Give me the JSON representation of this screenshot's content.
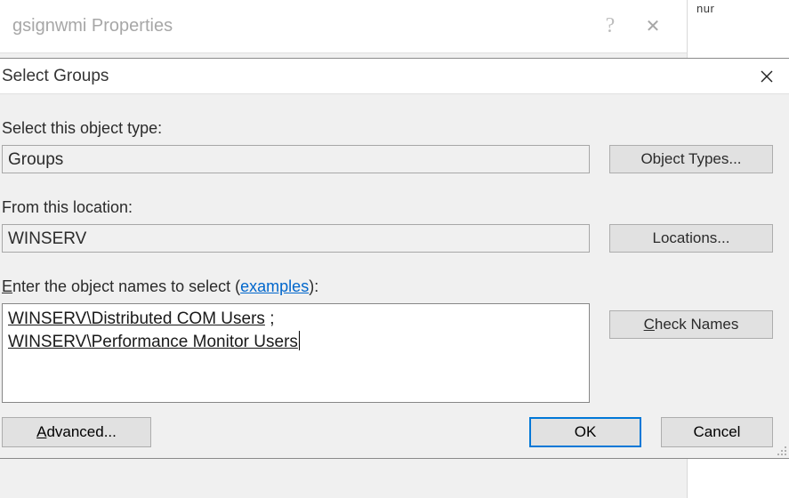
{
  "parent_window": {
    "title": "gsignwmi Properties",
    "help_glyph": "?",
    "close_glyph": "✕"
  },
  "right_strip": {
    "fragment": "nur"
  },
  "dialog": {
    "title": "Select Groups",
    "labels": {
      "object_type": "Select this object type:",
      "from_location": "From this location:",
      "enter_names_prefix": "E",
      "enter_names_rest": "nter the object names to select (",
      "examples_link": "examples",
      "enter_names_suffix": "):"
    },
    "values": {
      "object_type": "Groups",
      "from_location": "WINSERV",
      "name_line1": "WINSERV\\Distributed COM Users",
      "name_sep": " ;",
      "name_line2": "WINSERV\\Performance Monitor Users"
    },
    "buttons": {
      "object_types": "Object Types...",
      "locations": "Locations...",
      "check_names_c": "C",
      "check_names_rest": "heck Names",
      "advanced_a": "A",
      "advanced_rest": "dvanced...",
      "ok": "OK",
      "cancel": "Cancel"
    }
  }
}
